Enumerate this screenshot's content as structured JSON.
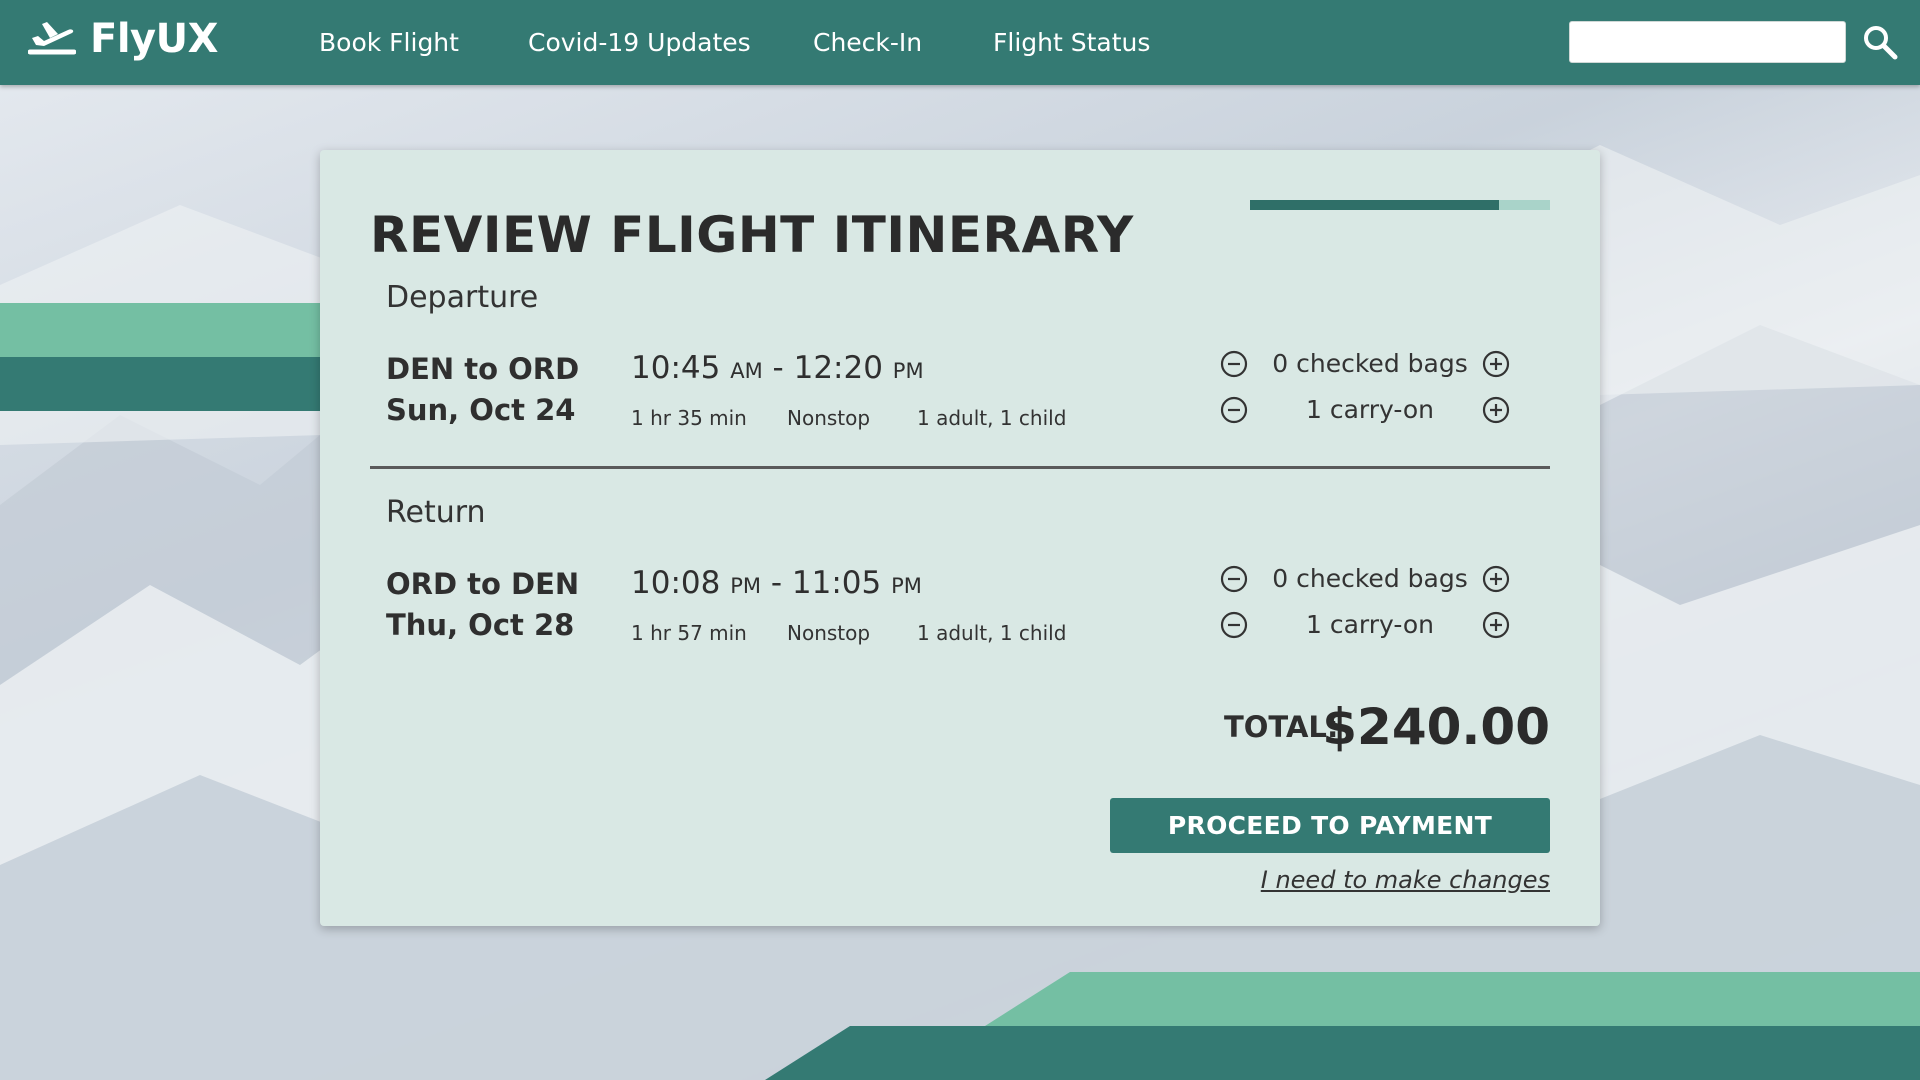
{
  "brand": {
    "name": "FlyUX"
  },
  "nav": {
    "links": [
      {
        "label": "Book Flight"
      },
      {
        "label": "Covid-19 Updates"
      },
      {
        "label": "Check-In"
      },
      {
        "label": "Flight Status"
      }
    ],
    "search": {
      "value": "",
      "placeholder": ""
    }
  },
  "itinerary": {
    "title": "REVIEW FLIGHT ITINERARY",
    "progress": 0.83,
    "departure": {
      "section": "Departure",
      "route": "DEN to ORD",
      "date": "Sun, Oct 24",
      "depart_time": "10:45",
      "depart_ampm": "AM",
      "separator": "-",
      "arrive_time": "12:20",
      "arrive_ampm": "PM",
      "duration": "1 hr 35 min",
      "stops": "Nonstop",
      "passengers": "1 adult, 1 child",
      "checked_bags": "0 checked bags",
      "carry_on": "1 carry-on"
    },
    "return": {
      "section": "Return",
      "route": "ORD to DEN",
      "date": "Thu, Oct 28",
      "depart_time": "10:08",
      "depart_ampm": "PM",
      "separator": "-",
      "arrive_time": "11:05",
      "arrive_ampm": "PM",
      "duration": "1 hr 57 min",
      "stops": "Nonstop",
      "passengers": "1 adult, 1 child",
      "checked_bags": "0 checked bags",
      "carry_on": "1 carry-on"
    },
    "total_label": "TOTAL:",
    "total_value": "$240.00",
    "proceed_label": "PROCEED TO PAYMENT",
    "changes_label": "I need to make changes"
  },
  "icons": {
    "logo": "airplane-takeoff-icon",
    "search": "search-icon",
    "decrement": "minus-circle-icon",
    "increment": "plus-circle-icon"
  },
  "colors": {
    "primary": "#347a73",
    "accent": "#74bfa3",
    "card_bg": "#d9e8e4",
    "progress_track": "#a9d3c9"
  }
}
